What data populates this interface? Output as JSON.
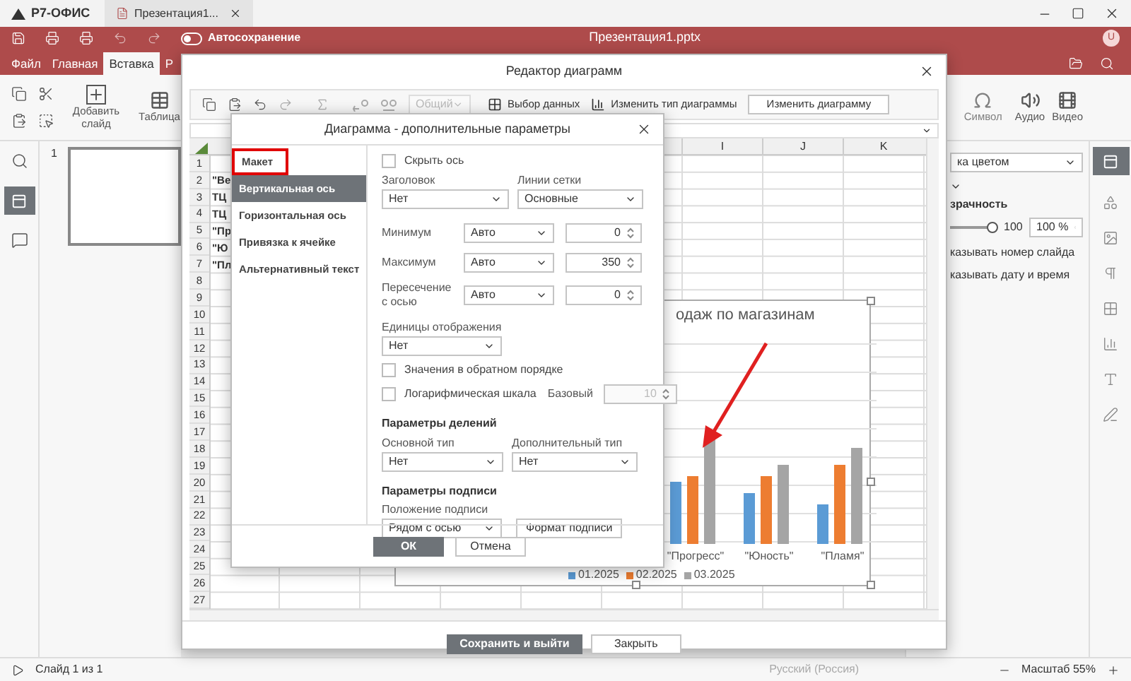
{
  "app": {
    "logo": "Р7-ОФИС",
    "doc_tab": "Презентация1...",
    "title": "Презентация1.pptx",
    "autosave": {
      "label": "Автосохранение",
      "on": false
    },
    "avatar": "U"
  },
  "menu_tabs": [
    {
      "label": "Файл",
      "selected": false
    },
    {
      "label": "Главная",
      "selected": false
    },
    {
      "label": "Вставка",
      "selected": true
    },
    {
      "label": "Р",
      "selected": false
    }
  ],
  "toolbar": {
    "add_slide": "Добавить слайд",
    "table": "Таблица",
    "symbol": "Символ",
    "audio": "Аудио",
    "video": "Видео"
  },
  "slides": [
    {
      "number": "1"
    }
  ],
  "right_panel": {
    "fill": "ка цветом",
    "transparency_label": "зрачность",
    "transparency": {
      "level": 1,
      "reading": "100"
    },
    "transparency_value": "100 %",
    "options": [
      {
        "label": "казывать номер слайда"
      },
      {
        "label": "казывать дату и время"
      }
    ]
  },
  "status_bar": {
    "slide": "Слайд 1 из 1",
    "language": "Русский (Россия)",
    "zoom": "Масштаб 55%"
  },
  "chart_editor": {
    "title": "Редактор диаграмм",
    "format": {
      "value": "Общий",
      "disabled": true
    },
    "select_data": "Выбор данных",
    "change_type": "Изменить тип диаграммы",
    "edit_chart": "Изменить диаграмму",
    "columns": [
      {
        "label": "I"
      },
      {
        "label": "J"
      },
      {
        "label": "K"
      }
    ],
    "rows": [
      {
        "number": "1"
      },
      {
        "number": "2",
        "cell": "\"Ве"
      },
      {
        "number": "3",
        "cell": "ТЦ"
      },
      {
        "number": "4",
        "cell": "ТЦ"
      },
      {
        "number": "5",
        "cell": "\"Пр"
      },
      {
        "number": "6",
        "cell": "\"Ю"
      },
      {
        "number": "7",
        "cell": "\"Пл"
      },
      {
        "number": "8"
      },
      {
        "number": "9"
      },
      {
        "number": "10"
      },
      {
        "number": "11"
      },
      {
        "number": "12"
      },
      {
        "number": "13"
      },
      {
        "number": "14"
      },
      {
        "number": "15"
      },
      {
        "number": "16"
      },
      {
        "number": "17"
      },
      {
        "number": "18"
      },
      {
        "number": "19"
      },
      {
        "number": "20"
      },
      {
        "number": "21"
      },
      {
        "number": "22"
      },
      {
        "number": "23"
      },
      {
        "number": "24"
      },
      {
        "number": "25"
      },
      {
        "number": "26"
      },
      {
        "number": "27"
      }
    ],
    "chart": {
      "title": "одаж по магазинам",
      "categories": [
        "\"Прогресс\"",
        "\"Юность\"",
        "\"Пламя\""
      ],
      "legend": [
        {
          "name": "01.2025",
          "color": "#5b9bd5"
        },
        {
          "name": "02.2025",
          "color": "#ed7d31"
        },
        {
          "name": "03.2025",
          "color": "#a5a5a5"
        }
      ]
    },
    "buttons": [
      {
        "label": "Сохранить и выйти",
        "kind": "primary"
      },
      {
        "label": "Закрыть",
        "kind": "secondary"
      }
    ]
  },
  "dialog": {
    "title": "Диаграмма - дополнительные параметры",
    "nav": [
      {
        "label": "Макет",
        "selected": false,
        "highlighted": true
      },
      {
        "label": "Вертикальная ось",
        "selected": true,
        "highlighted": false
      },
      {
        "label": "Горизонтальная ось",
        "selected": false,
        "highlighted": false
      },
      {
        "label": "Привязка к ячейке",
        "selected": false,
        "highlighted": false
      },
      {
        "label": "Альтернативный текст",
        "selected": false,
        "highlighted": false
      }
    ],
    "hide_axis": {
      "label": "Скрыть ось",
      "checked": false
    },
    "title_field": {
      "label": "Заголовок",
      "value": "Нет"
    },
    "gridlines": {
      "label": "Линии сетки",
      "value": "Основные"
    },
    "bounds": [
      {
        "label": "Минимум",
        "mode": "Авто",
        "value": "0"
      },
      {
        "label": "Максимум",
        "mode": "Авто",
        "value": "350"
      },
      {
        "label": "Пересечение с осью",
        "mode": "Авто",
        "value": "0"
      }
    ],
    "units": {
      "label": "Единицы отображения",
      "value": "Нет"
    },
    "reverse": {
      "label": "Значения в обратном порядке",
      "checked": false
    },
    "log": {
      "label": "Логарифмическая шкала",
      "checked": false,
      "base_label": "Базовый",
      "base": "10"
    },
    "ticks_heading": "Параметры делений",
    "major": {
      "label": "Основной тип",
      "value": "Нет"
    },
    "minor": {
      "label": "Дополнительный тип",
      "value": "Нет"
    },
    "labels_heading": "Параметры подписи",
    "label_position": {
      "label": "Положение подписи",
      "value": "Рядом с осью"
    },
    "label_format": "Формат подписи",
    "buttons": [
      {
        "label": "ОК",
        "kind": "primary"
      },
      {
        "label": "Отмена",
        "kind": "secondary"
      }
    ]
  }
}
